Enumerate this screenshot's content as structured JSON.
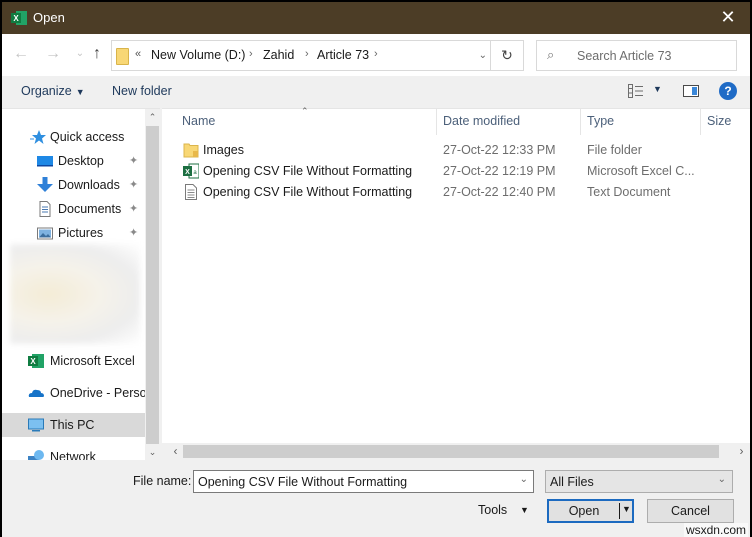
{
  "window": {
    "title": "Open",
    "close_glyph": "✕"
  },
  "nav": {
    "back_glyph": "←",
    "forward_glyph": "→",
    "recent_glyph": "⌄",
    "up_glyph": "↑",
    "overflow_glyph": "«",
    "breadcrumbs": [
      {
        "label": "New Volume (D:)"
      },
      {
        "label": "Zahid"
      },
      {
        "label": "Article 73"
      }
    ],
    "separator_glyph": "›",
    "dropdown_glyph": "⌄",
    "refresh_glyph": "↻",
    "search_placeholder": "Search Article 73",
    "search_glyph": "⌕"
  },
  "toolbar": {
    "organize_label": "Organize",
    "new_folder_label": "New folder",
    "caret_glyph": "▼",
    "help_glyph": "?"
  },
  "sidebar": {
    "items": [
      {
        "label": "Quick access",
        "icon": "star-icon"
      },
      {
        "label": "Desktop",
        "icon": "desktop-icon",
        "pinned": true
      },
      {
        "label": "Downloads",
        "icon": "downloads-icon",
        "pinned": true
      },
      {
        "label": "Documents",
        "icon": "documents-icon",
        "pinned": true
      },
      {
        "label": "Pictures",
        "icon": "pictures-icon",
        "pinned": true
      },
      {
        "label": "Microsoft Excel",
        "icon": "excel-icon"
      },
      {
        "label": "OneDrive - Personal",
        "icon": "onedrive-icon"
      },
      {
        "label": "This PC",
        "icon": "this-pc-icon",
        "selected": true
      },
      {
        "label": "Network",
        "icon": "network-icon"
      }
    ],
    "pin_glyph": "📌",
    "scroll_up_glyph": "⌃",
    "scroll_down_glyph": "⌄"
  },
  "files": {
    "sort_glyph": "⌃",
    "columns": [
      {
        "label": "Name"
      },
      {
        "label": "Date modified"
      },
      {
        "label": "Type"
      },
      {
        "label": "Size"
      }
    ],
    "rows": [
      {
        "name": "Images",
        "date": "27-Oct-22 12:33 PM",
        "type": "File folder",
        "size": "",
        "icon": "folder-icon"
      },
      {
        "name": "Opening CSV File Without Formatting",
        "date": "27-Oct-22 12:19 PM",
        "type": "Microsoft Excel C...",
        "size": "",
        "icon": "excel-csv-icon"
      },
      {
        "name": "Opening CSV File Without Formatting",
        "date": "27-Oct-22 12:40 PM",
        "type": "Text Document",
        "size": "",
        "icon": "text-document-icon"
      }
    ],
    "scroll_left_glyph": "‹",
    "scroll_right_glyph": "›"
  },
  "footer": {
    "file_name_label": "File name:",
    "file_name_value": "Opening CSV File Without Formatting",
    "file_type_value": "All Files",
    "dropdown_glyph": "⌄",
    "tools_label": "Tools",
    "caret_glyph": "▼",
    "open_label": "Open",
    "cancel_label": "Cancel"
  },
  "watermark": "wsxdn.com",
  "colors": {
    "titlebar": "#4c3d26",
    "accent": "#1c6ac0",
    "excel_green": "#1d6f42"
  }
}
